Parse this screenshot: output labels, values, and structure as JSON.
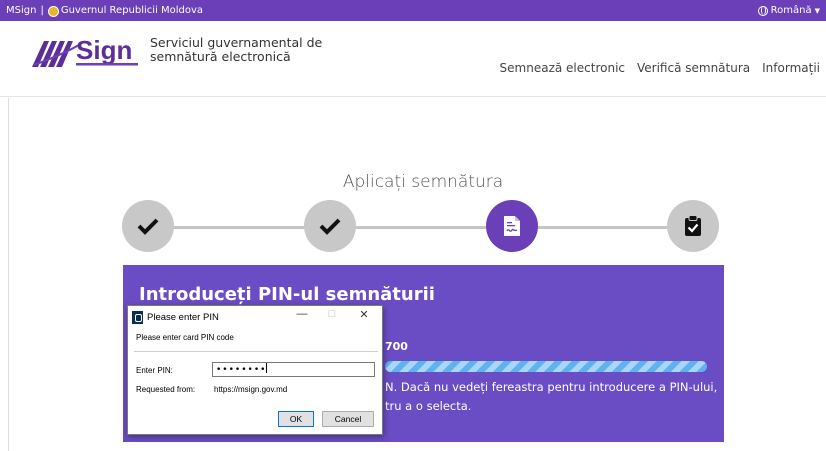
{
  "topbar": {
    "site": "MSign",
    "separator": "|",
    "gov": "Guvernul Republicii Moldova",
    "language": "Română"
  },
  "header": {
    "logo_text": "Sign",
    "tagline_line1": "Serviciul guvernamental de",
    "tagline_line2": "semnătură electronică",
    "nav": [
      "Semnează electronic",
      "Verifică semnătura",
      "Informații"
    ]
  },
  "main": {
    "title": "Aplicați semnătura",
    "steps": [
      {
        "icon": "check-icon",
        "state": "done"
      },
      {
        "icon": "check-icon",
        "state": "done"
      },
      {
        "icon": "document-signature-icon",
        "state": "active"
      },
      {
        "icon": "clipboard-check-icon",
        "state": "pending"
      }
    ],
    "panel": {
      "heading": "Introduceți PIN-ul semnăturii",
      "serial_fragment": "700",
      "message_line1": "N. Dacă nu vedeți fereastra pentru introducere a PIN-ului,",
      "message_line2": "tru a o selecta."
    }
  },
  "dialog": {
    "title": "Please enter PIN",
    "minimize": "—",
    "maximize": "□",
    "close": "✕",
    "prompt": "Please enter card PIN code",
    "pin_label": "Enter PIN:",
    "pin_value": "••••••••",
    "requested_label": "Requested from:",
    "requested_value": "https://msign.gov.md",
    "ok": "OK",
    "cancel": "Cancel"
  },
  "colors": {
    "brand_purple": "#6a3fb8",
    "panel_purple": "#6a4cc4",
    "step_inactive": "#c8c8c8",
    "progress_blue": "#5fb2ee"
  }
}
